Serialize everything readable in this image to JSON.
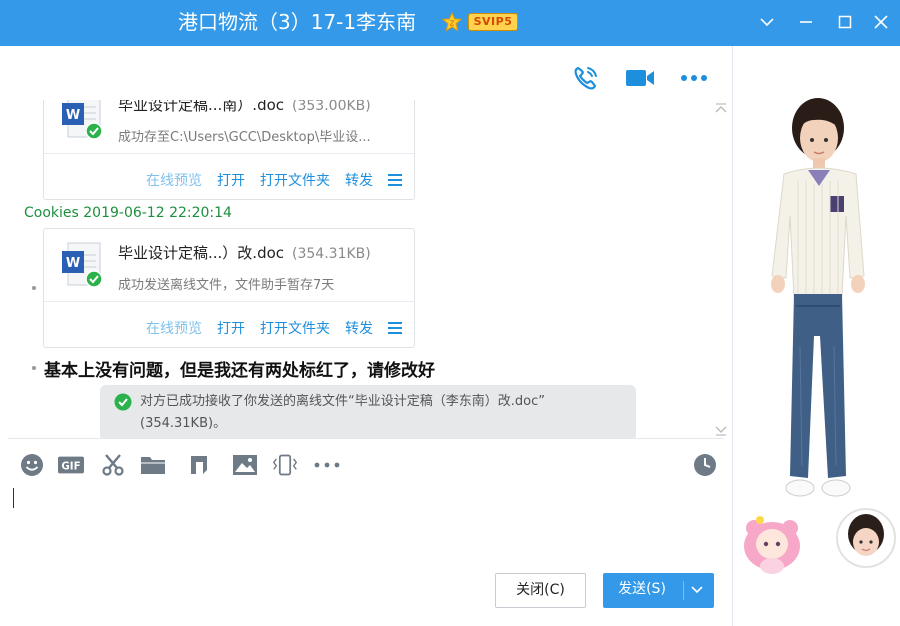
{
  "window": {
    "title": "港口物流（3）17-1李东南",
    "vip_badge": "SVIP5",
    "controls": [
      "chevron-down-icon",
      "minimize-icon",
      "maximize-icon",
      "close-icon"
    ]
  },
  "toolbar_top": {
    "icons": [
      "phone-call-icon",
      "video-call-icon",
      "more-icon"
    ]
  },
  "messages": [
    {
      "type": "file",
      "file_name": "毕业设计定稿...南）.doc",
      "file_size": "(353.00KB)",
      "status": "成功存至C:\\Users\\GCC\\Desktop\\毕业设...",
      "actions": [
        "在线预览",
        "打开",
        "打开文件夹",
        "转发"
      ]
    },
    {
      "type": "sender",
      "text": "Cookies 2019-06-12 22:20:14"
    },
    {
      "type": "file",
      "file_name": "毕业设计定稿...）改.doc",
      "file_size": "(354.31KB)",
      "status": "成功发送离线文件，文件助手暂存7天",
      "actions": [
        "在线预览",
        "打开",
        "打开文件夹",
        "转发"
      ]
    },
    {
      "type": "text",
      "text": "基本上没有问题，但是我还有两处标红了，请修改好"
    },
    {
      "type": "notice",
      "line1": "对方已成功接收了你发送的离线文件“毕业设计定稿（李东南）改.doc”",
      "line2": "(354.31KB)。"
    }
  ],
  "input_toolbar": {
    "icons": [
      "emoji-icon",
      "gif-icon",
      "scissors-icon",
      "folder-icon",
      "music-icon",
      "image-icon",
      "shake-icon",
      "more-icon",
      "history-clock-icon"
    ]
  },
  "buttons": {
    "close_label": "关闭(C)",
    "send_label": "发送(S)"
  },
  "colors": {
    "title_bar": "#3399e8",
    "accent": "#1d8fdc",
    "sender": "#1d8f3e",
    "success": "#2bb24c"
  }
}
